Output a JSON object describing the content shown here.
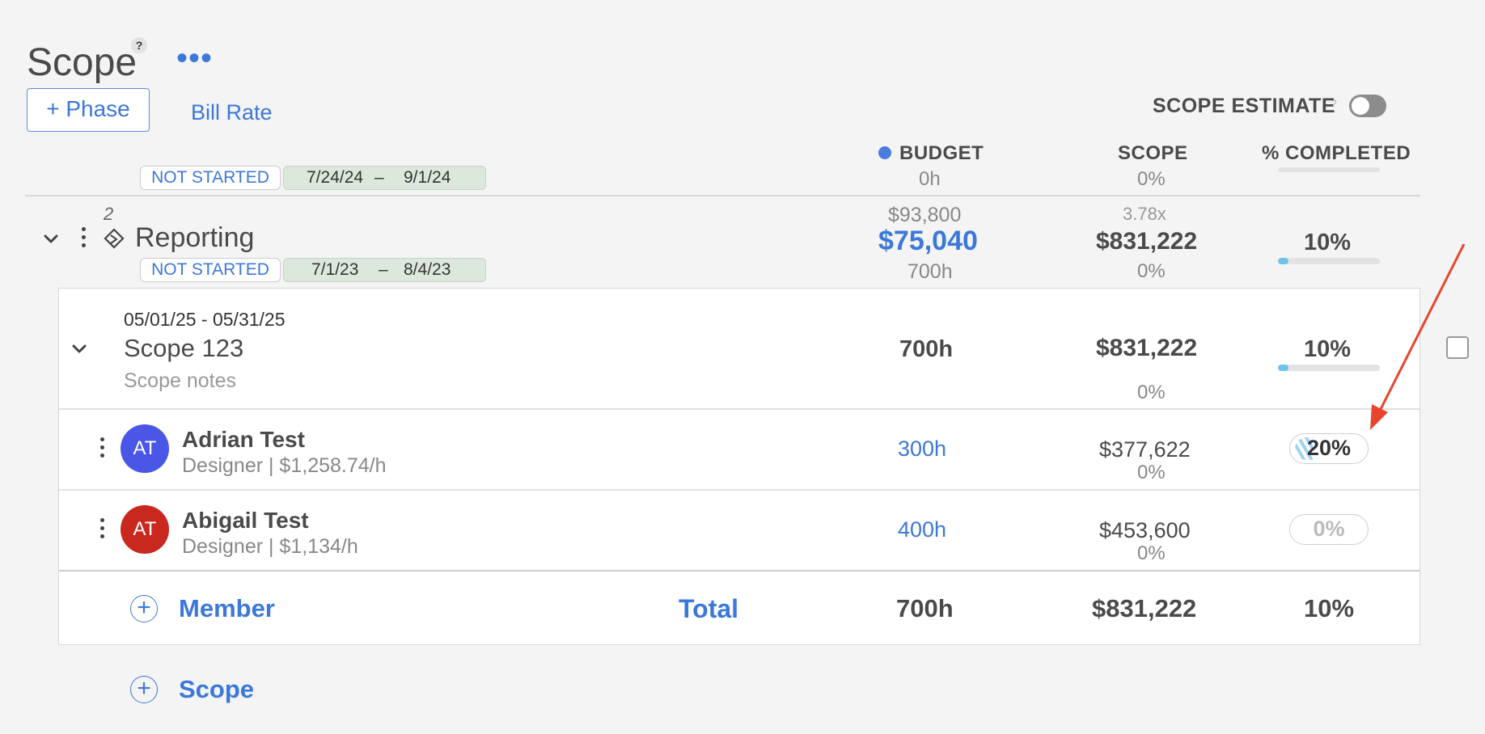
{
  "page": {
    "title": "Scope",
    "help": "?",
    "more": "•••",
    "phase_button": "+ Phase",
    "bill_rate": "Bill Rate",
    "scope_estimate_label": "SCOPE ESTIMATE",
    "scope_estimate_help": "?"
  },
  "columns": {
    "budget": "BUDGET",
    "scope": "SCOPE",
    "completed": "% COMPLETED"
  },
  "prev_phase": {
    "status": "NOT STARTED",
    "start": "7/24/24",
    "dash": "–",
    "end": "9/1/24",
    "budget_hours": "0h",
    "scope_pct": "0%"
  },
  "phase": {
    "number": "2",
    "name": "Reporting",
    "status": "NOT STARTED",
    "start": "7/1/23",
    "dash": "–",
    "end": "8/4/23",
    "budget_top": "$93,800",
    "budget_main": "$75,040",
    "budget_hours": "700h",
    "scope_multiplier": "3.78x",
    "scope_main": "$831,222",
    "scope_pct": "0%",
    "completed": "10%",
    "completed_value": 0.1
  },
  "scope_item": {
    "dates": "05/01/25 - 05/31/25",
    "name": "Scope 123",
    "notes": "Scope notes",
    "hours": "700h",
    "amount": "$831,222",
    "pct": "0%",
    "completed": "10%",
    "completed_value": 0.1
  },
  "members": [
    {
      "initials": "AT",
      "name": "Adrian Test",
      "role": "Designer | $1,258.74/h",
      "hours": "300h",
      "amount": "$377,622",
      "pct": "0%",
      "completed": "20%",
      "avatar_color": "#4a56e6"
    },
    {
      "initials": "AT",
      "name": "Abigail Test",
      "role": "Designer | $1,134/h",
      "hours": "400h",
      "amount": "$453,600",
      "pct": "0%",
      "completed": "0%",
      "avatar_color": "#c8281e"
    }
  ],
  "footer": {
    "add_member": "Member",
    "total_label": "Total",
    "total_hours": "700h",
    "total_amount": "$831,222",
    "total_completed": "10%",
    "add_scope": "Scope"
  },
  "colors": {
    "accent": "#3c78d8",
    "annotation_arrow": "#e8452c"
  }
}
